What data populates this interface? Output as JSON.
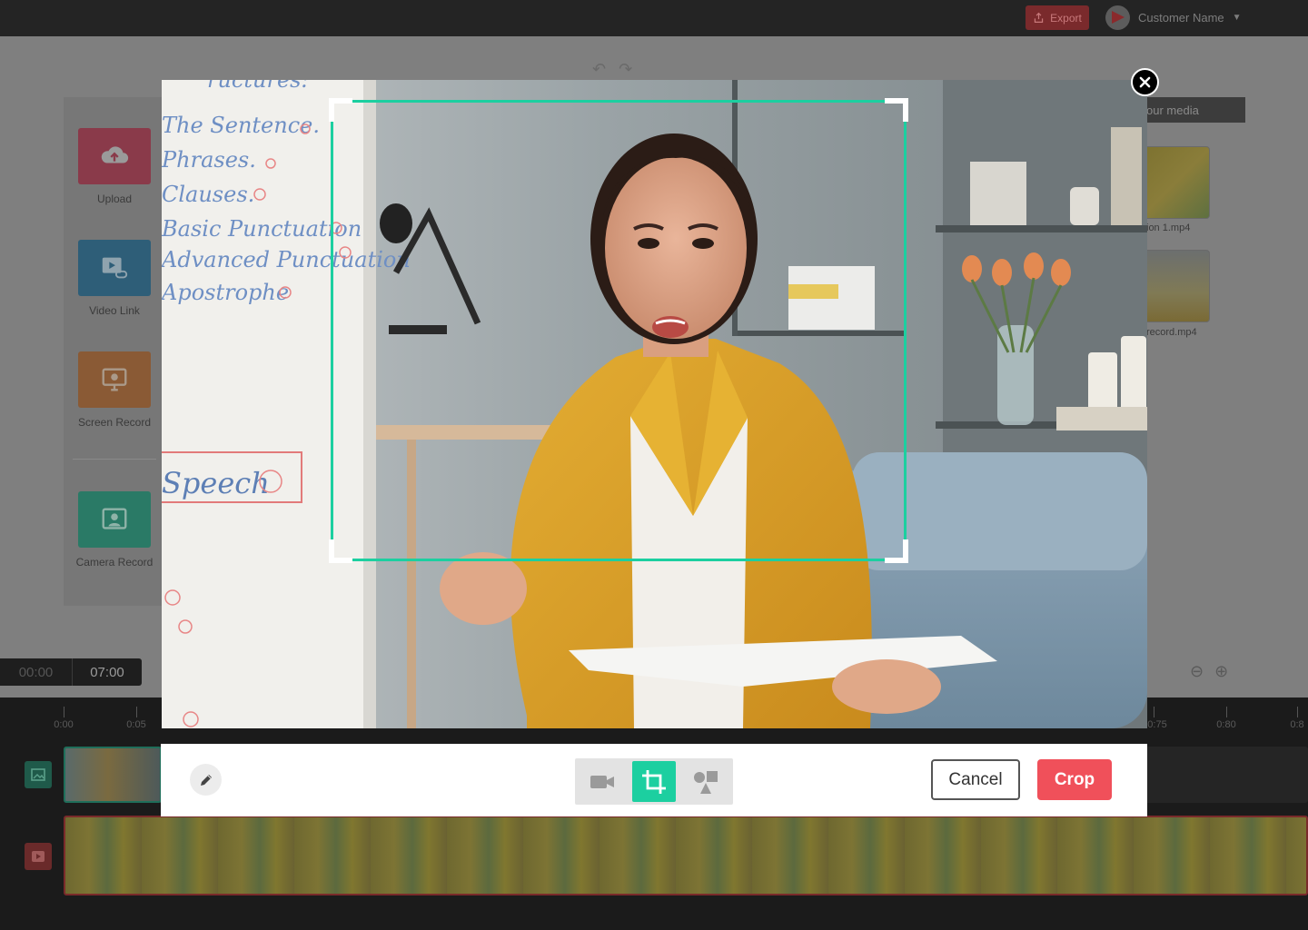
{
  "topbar": {
    "export_label": "Export",
    "customer_name": "Customer Name",
    "chevron_icon": "chevron-down-icon"
  },
  "tools": [
    {
      "label": "Upload",
      "icon": "cloud-upload-icon",
      "color": "#8a3a4a"
    },
    {
      "label": "Video Link",
      "icon": "video-link-icon",
      "color": "#2e5e78"
    },
    {
      "label": "Screen Record",
      "icon": "monitor-icon",
      "color": "#8a5a35"
    },
    {
      "label": "Camera Record",
      "icon": "camera-record-icon",
      "color": "#2a7a66"
    }
  ],
  "media": {
    "header": "our media",
    "items": [
      {
        "name": "ion 1.mp4"
      },
      {
        "name": "record.mp4"
      }
    ]
  },
  "playback": {
    "current_time": "00:00",
    "total_time": "07:00"
  },
  "ruler": {
    "labels": [
      "0:00",
      "0:05",
      "0:75",
      "0:80",
      "0:8"
    ]
  },
  "board_text": {
    "heading": "ructures:",
    "items": [
      "The Sentence.",
      "Phrases.",
      "Clauses.",
      "Basic Punctuation",
      "Advanced Punctuation",
      "Apostrophe"
    ],
    "speech": "Speech"
  },
  "crop_modal": {
    "cancel_label": "Cancel",
    "crop_label": "Crop",
    "modes": [
      {
        "name": "video",
        "icon": "video-camera-icon",
        "active": false
      },
      {
        "name": "crop",
        "icon": "crop-icon",
        "active": true
      },
      {
        "name": "shapes",
        "icon": "shapes-icon",
        "active": false
      }
    ],
    "accent_color": "#1ccfa0",
    "crop_button_color": "#f0505a"
  }
}
